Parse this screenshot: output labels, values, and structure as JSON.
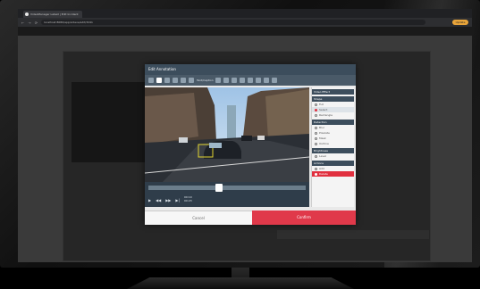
{
  "browser": {
    "tab_title": "VideoManager Latest | Edit Incident",
    "url": "localhost:8080/app/videos/edit/3241",
    "update_label": "Update",
    "back_icon": "arrow-left-icon",
    "forward_icon": "arrow-right-icon",
    "refresh_icon": "refresh-icon"
  },
  "modal": {
    "title": "Edit Annotation",
    "toolbar": {
      "text_tool_label": "Text/Caption",
      "icons": [
        "select-icon",
        "pen-icon",
        "arrow-icon",
        "text-icon",
        "shape-icon",
        "circle-icon",
        "rectangle-icon",
        "box-icon",
        "blur-icon",
        "undo-icon",
        "redo-icon",
        "crop-icon",
        "zoom-icon",
        "settings-icon"
      ]
    },
    "side_panel": {
      "title": "Video Effect",
      "groups": [
        {
          "label": "Shape",
          "options": [
            "Full",
            "Select",
            "Rectangle"
          ]
        },
        {
          "label": "Detection",
          "options": [
            "Blur",
            "Pixelate",
            "Mask",
            "Outline"
          ]
        },
        {
          "label": "Brightness",
          "options": [
            "Level"
          ]
        },
        {
          "label": "Actions",
          "options": [
            "Add",
            "Delete"
          ]
        }
      ]
    },
    "player": {
      "time": "00:10",
      "duration": "00:23",
      "progress": 0.45
    },
    "cancel_label": "Cancel",
    "confirm_label": "Confirm"
  },
  "colors": {
    "accent": "#e0394a",
    "header": "#3c4d5c",
    "update": "#e9a53a"
  }
}
